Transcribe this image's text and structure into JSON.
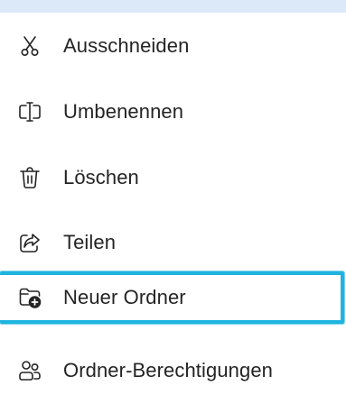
{
  "menu": {
    "items": [
      {
        "label": "Ausschneiden",
        "icon": "scissors-icon"
      },
      {
        "label": "Umbenennen",
        "icon": "rename-icon"
      },
      {
        "label": "Löschen",
        "icon": "trash-icon"
      },
      {
        "label": "Teilen",
        "icon": "share-icon"
      },
      {
        "label": "Neuer Ordner",
        "icon": "new-folder-icon",
        "focused": true
      },
      {
        "label": "Ordner-Berechtigungen",
        "icon": "people-icon"
      }
    ]
  },
  "colors": {
    "focus_border": "#1fb3e0",
    "text": "#242424",
    "icon": "#242424",
    "top_strip": "#dce9f9"
  }
}
